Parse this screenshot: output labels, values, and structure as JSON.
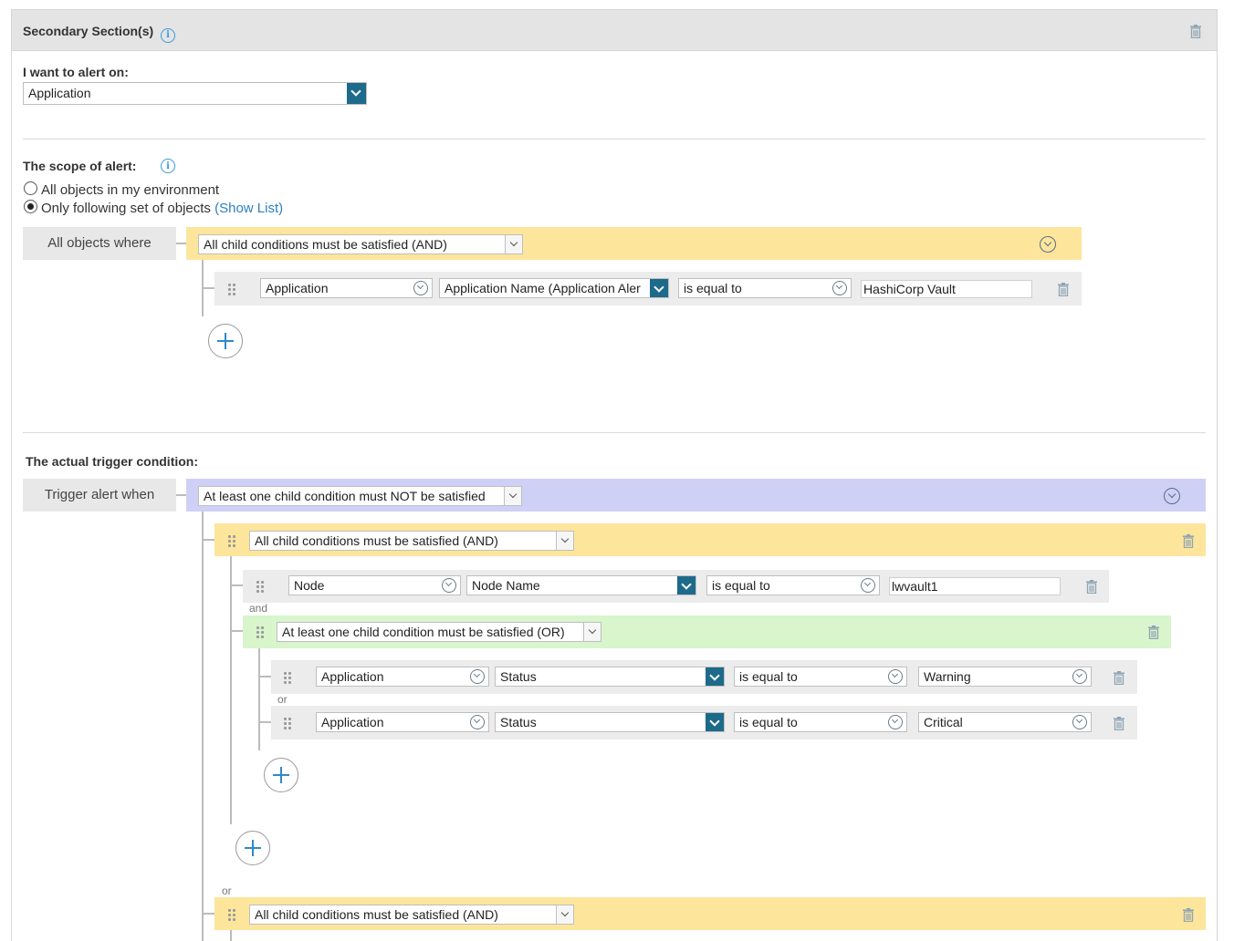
{
  "header": {
    "title": "Secondary Section(s)"
  },
  "alert_on": {
    "label": "I want to alert on:",
    "value": "Application"
  },
  "scope": {
    "label": "The scope of alert:",
    "options": [
      {
        "label": "All objects in my environment",
        "selected": false
      },
      {
        "label": "Only following set of objects",
        "selected": true
      }
    ],
    "show_list": "(Show List)",
    "side_label": "All objects where",
    "group": {
      "operator": "All child conditions must be satisfied (AND)"
    },
    "condition": {
      "object": "Application",
      "field": "Application Name (Application Aler",
      "comparison": "is equal to",
      "value": "HashiCorp Vault"
    }
  },
  "trigger": {
    "label": "The actual trigger condition:",
    "side_label": "Trigger alert when",
    "root_operator": "At least one child condition must NOT be satisfied",
    "group1": {
      "operator": "All child conditions must be satisfied (AND)",
      "condition": {
        "object": "Node",
        "field": "Node Name",
        "comparison": "is equal to",
        "value": "lwvault1"
      },
      "joiner": "and",
      "subgroup": {
        "operator": "At least one child condition must be satisfied (OR)",
        "conditions": [
          {
            "object": "Application",
            "field": "Status",
            "comparison": "is equal to",
            "value": "Warning"
          },
          {
            "object": "Application",
            "field": "Status",
            "comparison": "is equal to",
            "value": "Critical"
          }
        ],
        "joiner": "or"
      }
    },
    "joiner": "or",
    "group2": {
      "operator": "All child conditions must be satisfied (AND)"
    }
  },
  "icons": {
    "info": "info-icon",
    "trash": "trash-icon",
    "plus": "add-condition-icon",
    "collapse": "collapse-icon",
    "grip": "drag-handle-icon"
  },
  "colors": {
    "and_group": "#fde59c",
    "not_group": "#cfd0f6",
    "or_group": "#d8f5cc",
    "accent": "#1e6a8a",
    "link": "#2e7fc1"
  }
}
